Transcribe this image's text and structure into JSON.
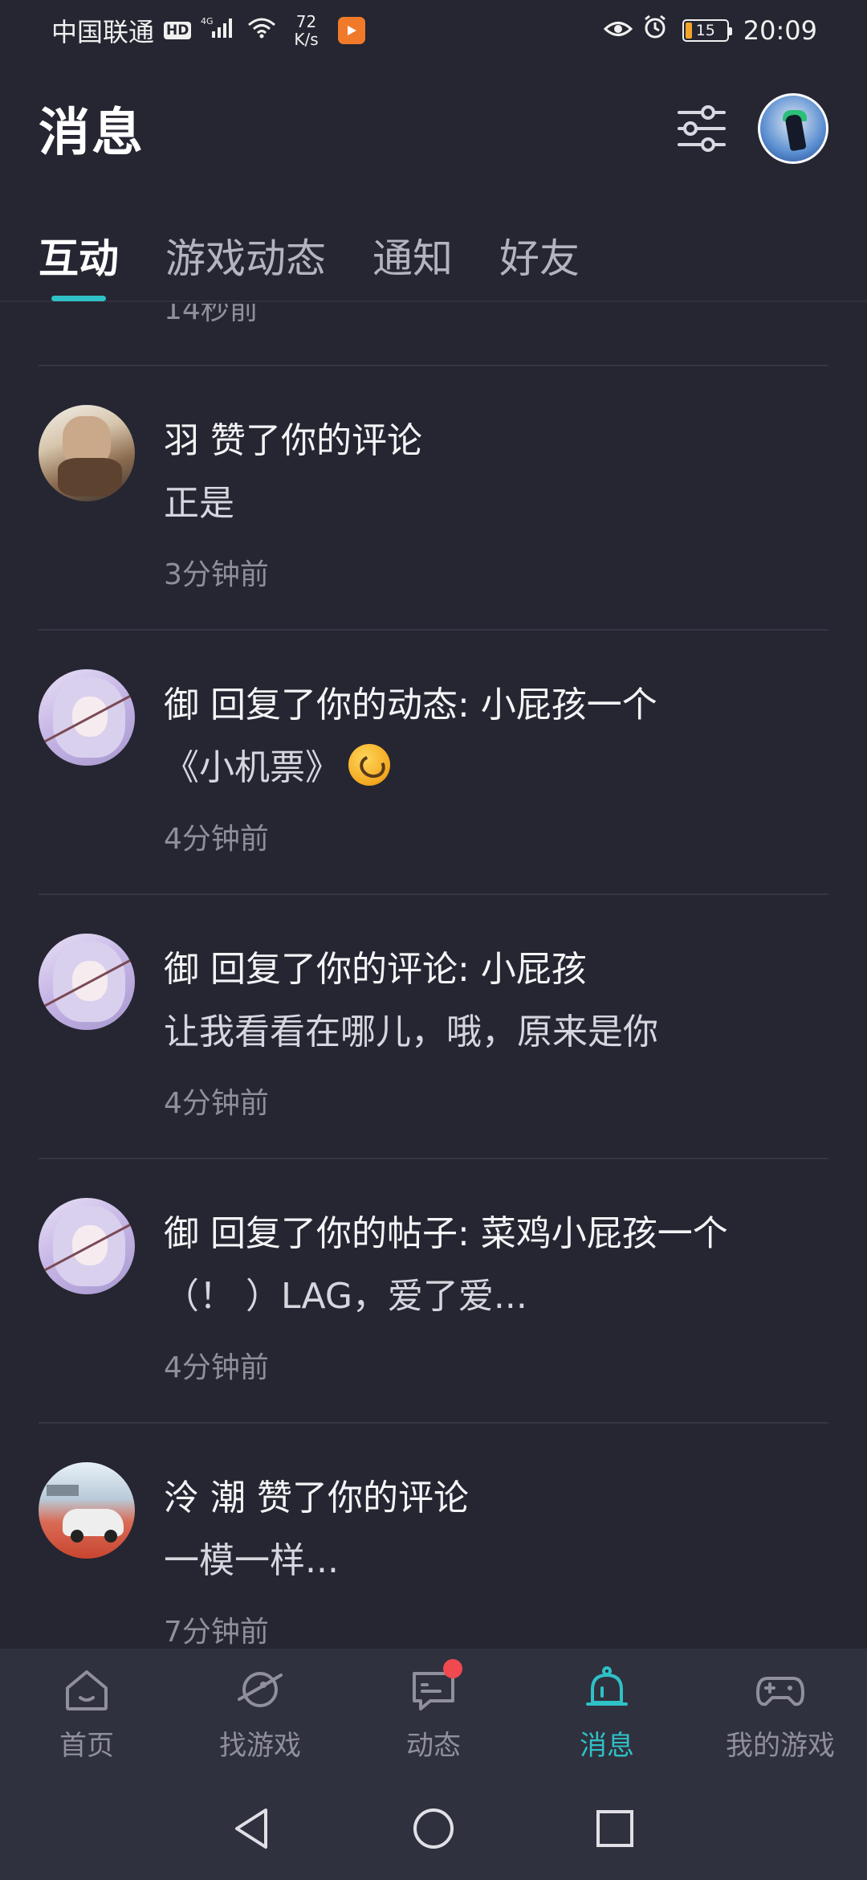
{
  "status_bar": {
    "carrier": "中国联通",
    "hd": "HD",
    "network": "4G",
    "speed_value": "72",
    "speed_unit": "K/s",
    "battery": "15",
    "time": "20:09"
  },
  "header": {
    "title": "消息"
  },
  "tabs": [
    {
      "label": "互动",
      "active": true
    },
    {
      "label": "游戏动态",
      "active": false
    },
    {
      "label": "通知",
      "active": false
    },
    {
      "label": "好友",
      "active": false
    }
  ],
  "partial_time": "14秒前",
  "messages": [
    {
      "title": "羽 赞了你的评论",
      "body": "正是",
      "time": "3分钟前",
      "avatar": "feather-avatar"
    },
    {
      "title": "御 回复了你的动态: 小屁孩一个",
      "body": "《小机票》",
      "time": "4分钟前",
      "avatar": "anime-girl-avatar",
      "emoji": "laughing-emoji"
    },
    {
      "title": "御 回复了你的评论: 小屁孩",
      "body": "让我看看在哪儿，哦，原来是你",
      "time": "4分钟前",
      "avatar": "anime-girl-avatar"
    },
    {
      "title": "御 回复了你的帖子: 菜鸡小屁孩一个",
      "body": "（！ ）LAG，爱了爱...",
      "time": "4分钟前",
      "avatar": "anime-girl-avatar"
    },
    {
      "title": "泠 潮 赞了你的评论",
      "body": "一模一样...",
      "time": "7分钟前",
      "avatar": "car-avatar"
    }
  ],
  "bottom_nav": [
    {
      "label": "首页",
      "icon": "home-icon",
      "active": false
    },
    {
      "label": "找游戏",
      "icon": "planet-icon",
      "active": false
    },
    {
      "label": "动态",
      "icon": "chat-icon",
      "active": false,
      "badge": true
    },
    {
      "label": "消息",
      "icon": "bell-icon",
      "active": true
    },
    {
      "label": "我的游戏",
      "icon": "gamepad-icon",
      "active": false
    }
  ],
  "colors": {
    "background": "#252631",
    "accent": "#2ec1c6",
    "badge": "#f0494f",
    "nav_background": "#30313e"
  }
}
